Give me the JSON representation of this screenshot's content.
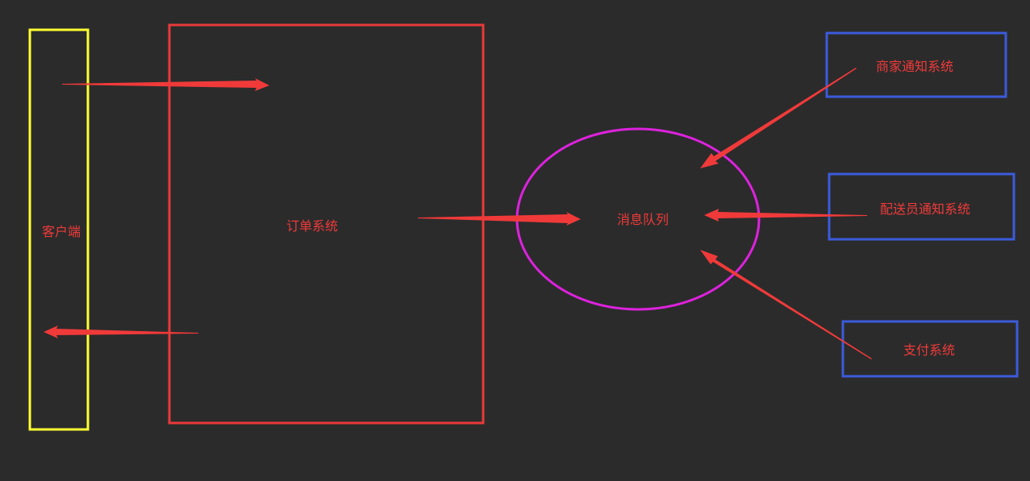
{
  "colors": {
    "background": "#2b2b2b",
    "client_border": "#ffff33",
    "order_border": "#e83a3a",
    "queue_border": "#dd22dd",
    "subscriber_border": "#3b5bdb",
    "arrow": "#f03a3a",
    "label_text": "#f03a3a"
  },
  "nodes": {
    "client": {
      "label": "客户端"
    },
    "order_system": {
      "label": "订单系统"
    },
    "message_queue": {
      "label": "消息队列"
    },
    "merchant_notify": {
      "label": "商家通知系统"
    },
    "courier_notify": {
      "label": "配送员通知系统"
    },
    "payment": {
      "label": "支付系统"
    }
  },
  "edges": [
    {
      "from": "client",
      "to": "order_system"
    },
    {
      "from": "order_system",
      "to": "client"
    },
    {
      "from": "order_system",
      "to": "message_queue"
    },
    {
      "from": "merchant_notify",
      "to": "message_queue"
    },
    {
      "from": "courier_notify",
      "to": "message_queue"
    },
    {
      "from": "payment",
      "to": "message_queue"
    }
  ]
}
